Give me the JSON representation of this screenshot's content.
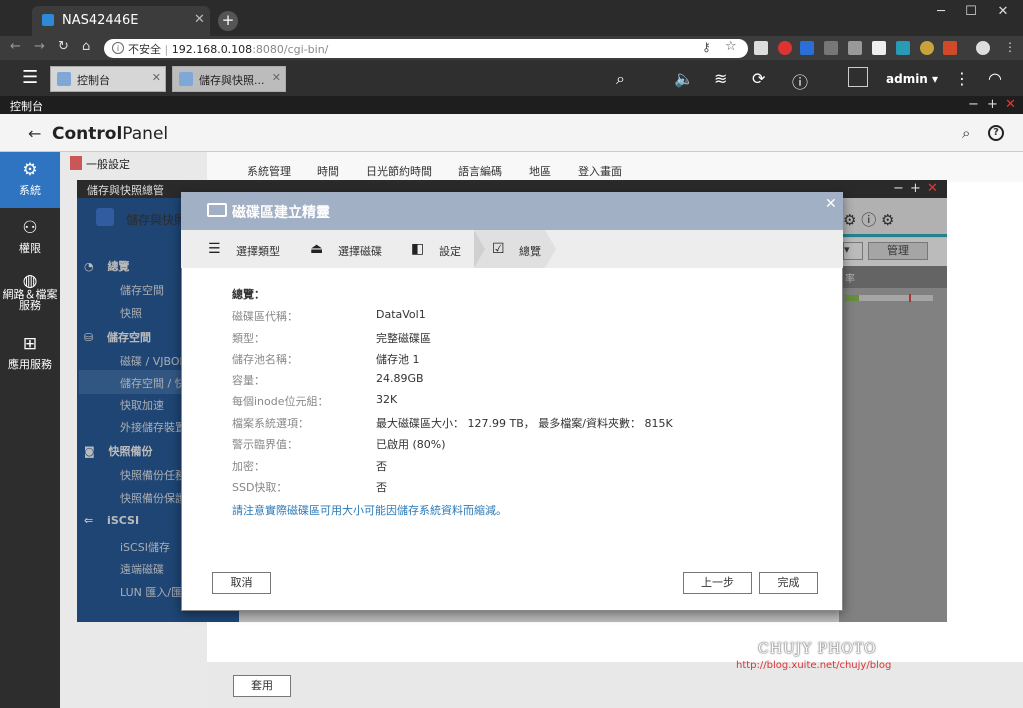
{
  "browser": {
    "tab_title": "NAS42446E",
    "tab_close": "✕",
    "new_tab": "+",
    "security_label": "不安全",
    "url_host": "192.168.0.108",
    "url_path": ":8080/cgi-bin/"
  },
  "appbar": {
    "tabs": [
      {
        "label": "控制台",
        "close": "✕"
      },
      {
        "label": "儲存與快照...",
        "close": "✕"
      }
    ],
    "user": "admin ▾"
  },
  "control_panel": {
    "window_title": "控制台",
    "logo_bold": "Control",
    "logo_light": "Panel",
    "rail": [
      {
        "label": "系統"
      },
      {
        "label": "權限"
      },
      {
        "label": "網路＆檔案服務"
      },
      {
        "label": "應用服務"
      }
    ],
    "sub_header": "一般設定",
    "subtabs": [
      "系統管理",
      "時間",
      "日光節約時間",
      "語言編碼",
      "地區",
      "登入畫面"
    ],
    "apply": "套用"
  },
  "storage_manager": {
    "window_title": "儲存與快照總管",
    "app_title": "儲存與快照",
    "manage_button": "管理",
    "column_fragment": "率",
    "sidebar": [
      {
        "label": "總覽",
        "head": true
      },
      {
        "label": "儲存空間"
      },
      {
        "label": "快照"
      },
      {
        "label": "儲存空間",
        "head": true
      },
      {
        "label": "磁碟 / VJBOD"
      },
      {
        "label": "儲存空間 / 快"
      },
      {
        "label": "快取加速"
      },
      {
        "label": "外接儲存裝置"
      },
      {
        "label": "快照備份",
        "head": true
      },
      {
        "label": "快照備份任務"
      },
      {
        "label": "快照備份保護"
      },
      {
        "label": "iSCSI",
        "head": true
      },
      {
        "label": "iSCSI儲存"
      },
      {
        "label": "遠端磁碟"
      },
      {
        "label": "LUN 匯入/匯出"
      }
    ]
  },
  "dialog": {
    "title": "磁碟區建立精靈",
    "close": "✕",
    "steps": [
      "選擇類型",
      "選擇磁碟",
      "設定",
      "總覽"
    ],
    "summary_title": "總覽：",
    "rows": [
      {
        "label": "磁碟區代稱：",
        "value": "DataVol1"
      },
      {
        "label": "類型：",
        "value": "完整磁碟區"
      },
      {
        "label": "儲存池名稱：",
        "value": "儲存池 1"
      },
      {
        "label": "容量：",
        "value": "24.89GB"
      },
      {
        "label": "每個inode位元組：",
        "value": "32K"
      },
      {
        "label": "檔案系統選項：",
        "value": "最大磁碟區大小： 127.99 TB， 最多檔案/資料夾數： 815K"
      },
      {
        "label": "警示臨界值：",
        "value": "已啟用 (80%)"
      },
      {
        "label": "加密：",
        "value": "否"
      },
      {
        "label": "SSD快取：",
        "value": "否"
      }
    ],
    "note": "請注意實際磁碟區可用大小可能因儲存系統資料而縮減。",
    "cancel": "取消",
    "prev": "上一步",
    "finish": "完成"
  },
  "watermark": {
    "brand": "CHUJY PHOTO",
    "url": "http://blog.xuite.net/chujy/blog"
  }
}
